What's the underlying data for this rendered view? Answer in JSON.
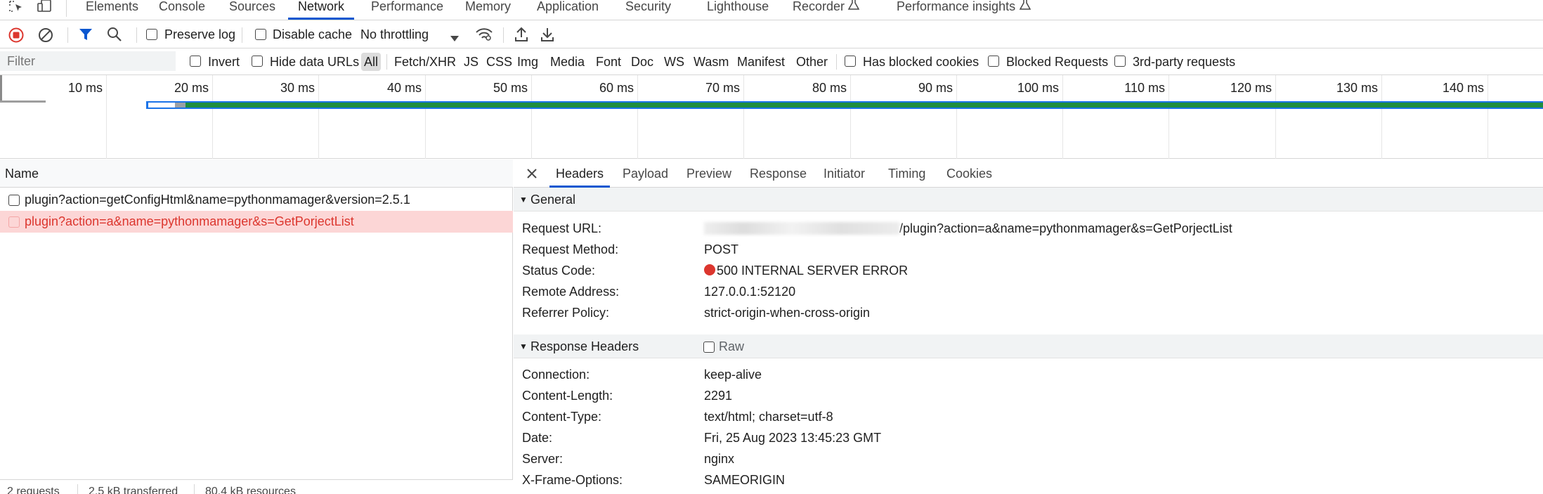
{
  "tabs": {
    "items": [
      "Elements",
      "Console",
      "Sources",
      "Network",
      "Performance",
      "Memory",
      "Application",
      "Security",
      "Lighthouse",
      "Recorder",
      "Performance insights"
    ],
    "active": "Network"
  },
  "toolbar": {
    "preserve_log": "Preserve log",
    "disable_cache": "Disable cache",
    "throttling": "No throttling"
  },
  "filterbar": {
    "placeholder": "Filter",
    "invert": "Invert",
    "hide_data_urls": "Hide data URLs",
    "types": [
      "All",
      "Fetch/XHR",
      "JS",
      "CSS",
      "Img",
      "Media",
      "Font",
      "Doc",
      "WS",
      "Wasm",
      "Manifest",
      "Other"
    ],
    "has_blocked_cookies": "Has blocked cookies",
    "blocked_requests": "Blocked Requests",
    "third_party": "3rd-party requests"
  },
  "overview": {
    "ticks": [
      "10 ms",
      "20 ms",
      "30 ms",
      "40 ms",
      "50 ms",
      "60 ms",
      "70 ms",
      "80 ms",
      "90 ms",
      "100 ms",
      "110 ms",
      "120 ms",
      "130 ms",
      "140 ms"
    ]
  },
  "requests": {
    "column": "Name",
    "rows": [
      {
        "name": "plugin?action=getConfigHtml&name=pythonmamager&version=2.5.1",
        "error": false
      },
      {
        "name": "plugin?action=a&name=pythonmamager&s=GetPorjectList",
        "error": true
      }
    ],
    "status": {
      "count": "2 requests",
      "transferred": "2.5 kB transferred",
      "resources": "80.4 kB resources"
    }
  },
  "detail": {
    "tabs": [
      "Headers",
      "Payload",
      "Preview",
      "Response",
      "Initiator",
      "Timing",
      "Cookies"
    ],
    "active_tab": "Headers",
    "general": {
      "title": "General",
      "rows": [
        {
          "key": "Request URL:",
          "value": "/plugin?action=a&name=pythonmamager&s=GetPorjectList"
        },
        {
          "key": "Request Method:",
          "value": "POST"
        },
        {
          "key": "Status Code:",
          "value": "500 INTERNAL SERVER ERROR"
        },
        {
          "key": "Remote Address:",
          "value": "127.0.0.1:52120"
        },
        {
          "key": "Referrer Policy:",
          "value": "strict-origin-when-cross-origin"
        }
      ]
    },
    "response_headers": {
      "title": "Response Headers",
      "raw_label": "Raw",
      "rows": [
        {
          "key": "Connection:",
          "value": "keep-alive"
        },
        {
          "key": "Content-Length:",
          "value": "2291"
        },
        {
          "key": "Content-Type:",
          "value": "text/html; charset=utf-8"
        },
        {
          "key": "Date:",
          "value": "Fri, 25 Aug 2023 13:45:23 GMT"
        },
        {
          "key": "Server:",
          "value": "nginx"
        },
        {
          "key": "X-Frame-Options:",
          "value": "SAMEORIGIN"
        }
      ]
    }
  },
  "colors": {
    "accent": "#0b57d0",
    "error": "#dc362e",
    "error_row_bg": "#fcd6d6",
    "waterfall_green": "#1e8e3e",
    "waterfall_blue": "#1a73e8"
  }
}
